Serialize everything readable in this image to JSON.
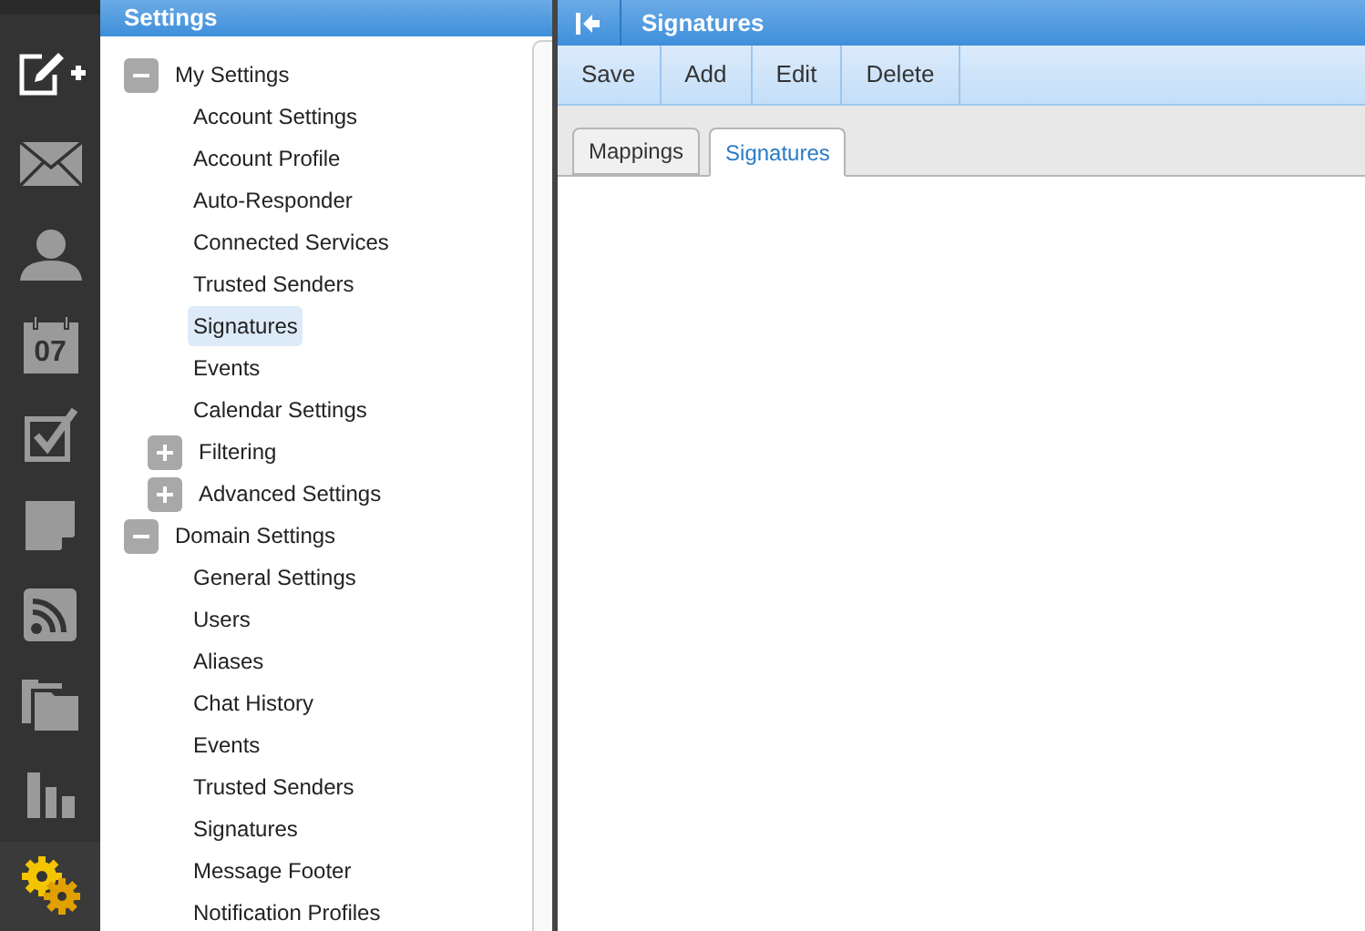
{
  "nav": [
    {
      "kind": "compose",
      "selected": false
    },
    {
      "kind": "mail",
      "selected": false
    },
    {
      "kind": "contacts",
      "selected": false
    },
    {
      "kind": "calendar",
      "text": "07",
      "selected": false
    },
    {
      "kind": "tasks",
      "selected": false
    },
    {
      "kind": "notes",
      "selected": false
    },
    {
      "kind": "feeds",
      "selected": false
    },
    {
      "kind": "files",
      "selected": false
    },
    {
      "kind": "reports",
      "selected": false
    },
    {
      "kind": "settings",
      "selected": true
    }
  ],
  "settings_panel": {
    "title": "Settings",
    "tree": [
      {
        "label": "My Settings",
        "expanded": true,
        "selected": false,
        "children": [
          {
            "label": "Account Settings",
            "selected": false
          },
          {
            "label": "Account Profile",
            "selected": false
          },
          {
            "label": "Auto-Responder",
            "selected": false
          },
          {
            "label": "Connected Services",
            "selected": false
          },
          {
            "label": "Trusted Senders",
            "selected": false
          },
          {
            "label": "Signatures",
            "selected": true
          },
          {
            "label": "Events",
            "selected": false
          },
          {
            "label": "Calendar Settings",
            "selected": false
          },
          {
            "label": "Filtering",
            "expanded": false,
            "selected": false
          },
          {
            "label": "Advanced Settings",
            "expanded": false,
            "selected": false
          }
        ]
      },
      {
        "label": "Domain Settings",
        "expanded": true,
        "selected": false,
        "children": [
          {
            "label": "General Settings",
            "selected": false
          },
          {
            "label": "Users",
            "selected": false
          },
          {
            "label": "Aliases",
            "selected": false
          },
          {
            "label": "Chat History",
            "selected": false
          },
          {
            "label": "Events",
            "selected": false
          },
          {
            "label": "Trusted Senders",
            "selected": false
          },
          {
            "label": "Signatures",
            "selected": false
          },
          {
            "label": "Message Footer",
            "selected": false
          },
          {
            "label": "Notification Profiles",
            "selected": false
          }
        ]
      }
    ]
  },
  "content": {
    "title": "Signatures",
    "toolbar": [
      "Save",
      "Add",
      "Edit",
      "Delete"
    ],
    "tabs": [
      {
        "label": "Mappings",
        "selected": false
      },
      {
        "label": "Signatures",
        "selected": true
      }
    ]
  }
}
